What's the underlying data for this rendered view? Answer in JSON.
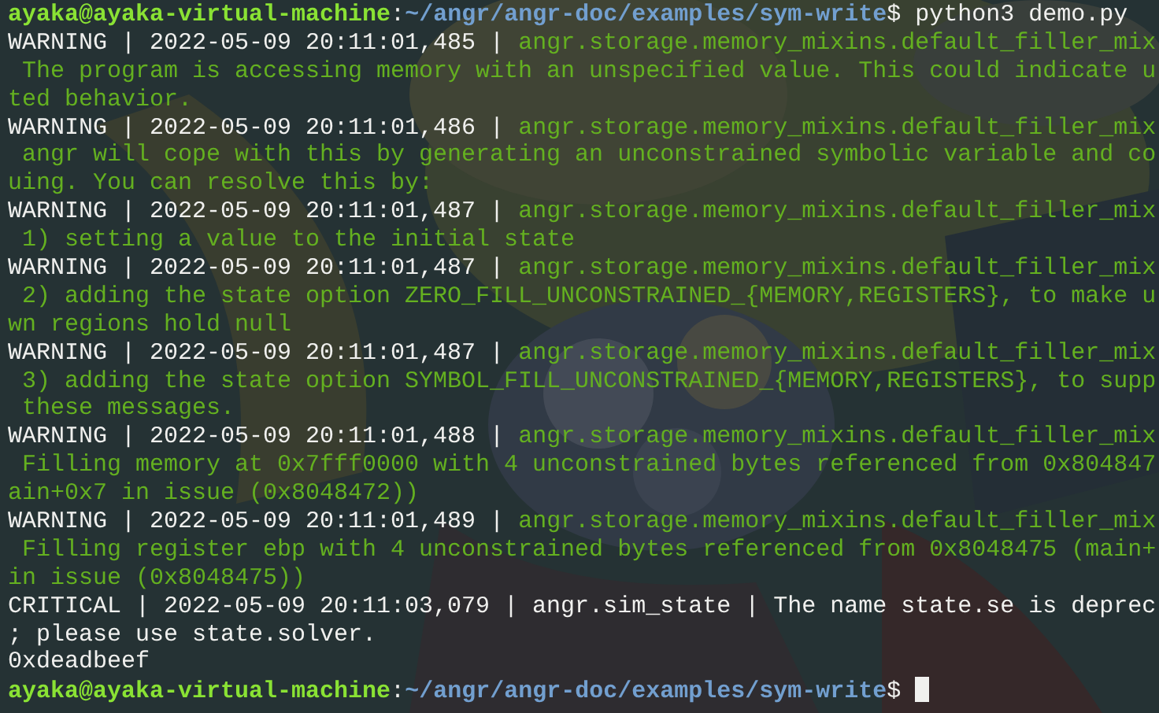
{
  "terminal": {
    "lines": [
      {
        "kind": "prompt",
        "user": "ayaka@ayaka-virtual-machine",
        "separator": ":",
        "path": "~/angr/angr-doc/examples/sym-write",
        "symbol": "$",
        "command": "python3 demo.py"
      },
      {
        "kind": "log",
        "head": "WARNING | 2022-05-09 20:11:01,485 | ",
        "source": "angr.storage.memory_mixins.default_filler_mix",
        "color": "#64b020"
      },
      {
        "kind": "message",
        "color": "#64b020",
        "text": " The program is accessing memory with an unspecified value. This could indicate u"
      },
      {
        "kind": "message",
        "color": "#64b020",
        "text": "ted behavior."
      },
      {
        "kind": "log",
        "head": "WARNING | 2022-05-09 20:11:01,486 | ",
        "source": "angr.storage.memory_mixins.default_filler_mix",
        "color": "#64b020"
      },
      {
        "kind": "message",
        "color": "#64b020",
        "text": " angr will cope with this by generating an unconstrained symbolic variable and co"
      },
      {
        "kind": "message",
        "color": "#64b020",
        "text": "uing. You can resolve this by:"
      },
      {
        "kind": "log",
        "head": "WARNING | 2022-05-09 20:11:01,487 | ",
        "source": "angr.storage.memory_mixins.default_filler_mix",
        "color": "#64b020"
      },
      {
        "kind": "message",
        "color": "#64b020",
        "text": " 1) setting a value to the initial state"
      },
      {
        "kind": "log",
        "head": "WARNING | 2022-05-09 20:11:01,487 | ",
        "source": "angr.storage.memory_mixins.default_filler_mix",
        "color": "#64b020"
      },
      {
        "kind": "message",
        "color": "#64b020",
        "text": " 2) adding the state option ZERO_FILL_UNCONSTRAINED_{MEMORY,REGISTERS}, to make u"
      },
      {
        "kind": "message",
        "color": "#64b020",
        "text": "wn regions hold null"
      },
      {
        "kind": "log",
        "head": "WARNING | 2022-05-09 20:11:01,487 | ",
        "source": "angr.storage.memory_mixins.default_filler_mix",
        "color": "#64b020"
      },
      {
        "kind": "message",
        "color": "#64b020",
        "text": " 3) adding the state option SYMBOL_FILL_UNCONSTRAINED_{MEMORY,REGISTERS}, to supp"
      },
      {
        "kind": "message",
        "color": "#64b020",
        "text": " these messages."
      },
      {
        "kind": "log",
        "head": "WARNING | 2022-05-09 20:11:01,488 | ",
        "source": "angr.storage.memory_mixins.default_filler_mix",
        "color": "#64b020"
      },
      {
        "kind": "message",
        "color": "#64b020",
        "text": " Filling memory at 0x7fff0000 with 4 unconstrained bytes referenced from 0x804847"
      },
      {
        "kind": "message",
        "color": "#64b020",
        "text": "ain+0x7 in issue (0x8048472))"
      },
      {
        "kind": "log",
        "head": "WARNING | 2022-05-09 20:11:01,489 | ",
        "source": "angr.storage.memory_mixins.default_filler_mix",
        "color": "#64b020"
      },
      {
        "kind": "message",
        "color": "#64b020",
        "text": " Filling register ebp with 4 unconstrained bytes referenced from 0x8048475 (main+"
      },
      {
        "kind": "message",
        "color": "#64b020",
        "text": "in issue (0x8048475))"
      },
      {
        "kind": "log",
        "head": "CRITICAL | 2022-05-09 20:11:03,079 | angr.sim_state | The name state.se is deprec"
      },
      {
        "kind": "message",
        "text": "; please use state.solver."
      },
      {
        "kind": "output",
        "text": "0xdeadbeef"
      },
      {
        "kind": "prompt",
        "user": "ayaka@ayaka-virtual-machine",
        "separator": ":",
        "path": "~/angr/angr-doc/examples/sym-write",
        "symbol": "$",
        "cursor": true
      }
    ]
  }
}
